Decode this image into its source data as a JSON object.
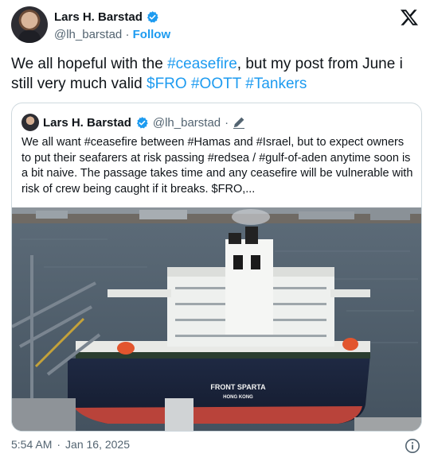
{
  "author": {
    "name": "Lars H. Barstad",
    "handle": "@lh_barstad",
    "separator": "·",
    "follow_label": "Follow"
  },
  "tweet": {
    "text_1": "We all hopeful with the ",
    "tag_ceasefire": "#ceasefire",
    "text_2": ", but my post from June i still very much valid ",
    "tag_fro": "$FRO",
    "tag_oott": "#OOTT",
    "tag_tankers": "#Tankers"
  },
  "quote": {
    "name": "Lars H. Barstad",
    "handle": "@lh_barstad",
    "separator": "·",
    "text": "We all want #ceasefire between #Hamas and #Israel, but to expect owners to put their seafarers at risk passing #redsea / #gulf-of-aden anytime soon is a bit naive. The passage takes time and any ceasefire will be vulnerable with risk of crew being caught if it breaks. $FRO,...",
    "ship_name": "FRONT SPARTA",
    "ship_port": "HONG KONG"
  },
  "footer": {
    "time": "5:54 AM",
    "separator": "·",
    "date": "Jan 16, 2025"
  },
  "icons": {
    "verified": "verified-badge-icon",
    "x_logo": "x-logo-icon",
    "edit": "edit-pencil-icon",
    "info": "info-icon"
  },
  "colors": {
    "link": "#1d9bf0",
    "secondary_text": "#536471",
    "border": "#cfd9de"
  }
}
